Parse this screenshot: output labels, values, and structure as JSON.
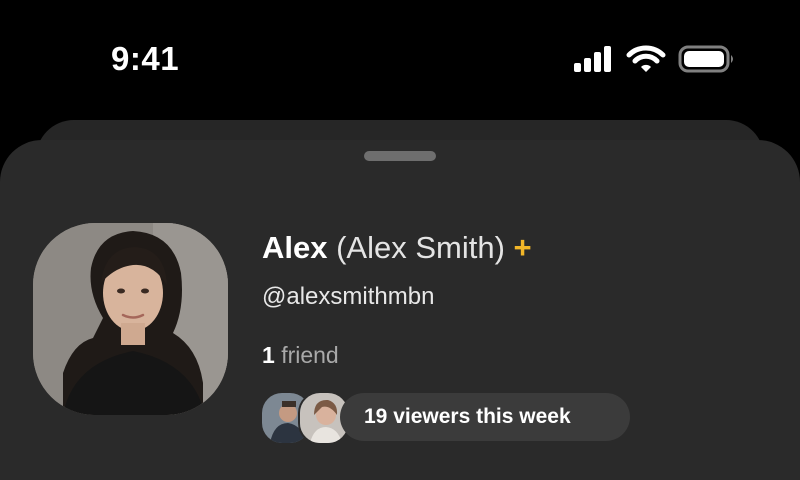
{
  "status_bar": {
    "time": "9:41",
    "icons": [
      "cellular-signal-icon",
      "wifi-icon",
      "battery-icon"
    ]
  },
  "profile": {
    "display_name": "Alex",
    "full_name": "(Alex Smith)",
    "badge": "+",
    "username": "@alexsmithmbn",
    "friends_count": "1",
    "friends_label": "friend",
    "viewers_text": "19 viewers this week"
  },
  "colors": {
    "background": "#000000",
    "sheet": "#2a2a2a",
    "accent_badge": "#f2b628",
    "pill": "#3b3b3b"
  }
}
